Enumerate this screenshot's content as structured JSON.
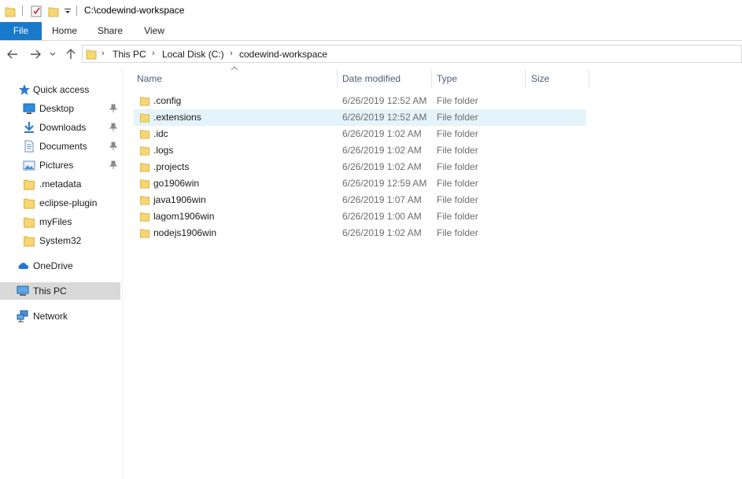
{
  "window": {
    "title": "C:\\codewind-workspace"
  },
  "ribbon": {
    "tabs": [
      "File",
      "Home",
      "Share",
      "View"
    ]
  },
  "address": {
    "crumbs": [
      "This PC",
      "Local Disk (C:)",
      "codewind-workspace"
    ]
  },
  "nav": {
    "quick_access": "Quick access",
    "items": [
      {
        "label": "Desktop",
        "icon": "desktop-icon",
        "pinned": true
      },
      {
        "label": "Downloads",
        "icon": "downloads-icon",
        "pinned": true
      },
      {
        "label": "Documents",
        "icon": "documents-icon",
        "pinned": true
      },
      {
        "label": "Pictures",
        "icon": "pictures-icon",
        "pinned": true
      },
      {
        "label": ".metadata",
        "icon": "folder-icon",
        "pinned": false
      },
      {
        "label": "eclipse-plugin",
        "icon": "folder-icon",
        "pinned": false
      },
      {
        "label": "myFiles",
        "icon": "folder-icon",
        "pinned": false
      },
      {
        "label": "System32",
        "icon": "folder-icon",
        "pinned": false
      }
    ],
    "onedrive": "OneDrive",
    "thispc": "This PC",
    "network": "Network"
  },
  "columns": {
    "name": "Name",
    "date": "Date modified",
    "type": "Type",
    "size": "Size"
  },
  "files": [
    {
      "name": ".config",
      "date": "6/26/2019 12:52 AM",
      "type": "File folder"
    },
    {
      "name": ".extensions",
      "date": "6/26/2019 12:52 AM",
      "type": "File folder"
    },
    {
      "name": ".idc",
      "date": "6/26/2019 1:02 AM",
      "type": "File folder"
    },
    {
      "name": ".logs",
      "date": "6/26/2019 1:02 AM",
      "type": "File folder"
    },
    {
      "name": ".projects",
      "date": "6/26/2019 1:02 AM",
      "type": "File folder"
    },
    {
      "name": "go1906win",
      "date": "6/26/2019 12:59 AM",
      "type": "File folder"
    },
    {
      "name": "java1906win",
      "date": "6/26/2019 1:07 AM",
      "type": "File folder"
    },
    {
      "name": "lagom1906win",
      "date": "6/26/2019 1:00 AM",
      "type": "File folder"
    },
    {
      "name": "nodejs1906win",
      "date": "6/26/2019 1:02 AM",
      "type": "File folder"
    }
  ],
  "colors": {
    "file_tab": "#1979ca",
    "folder": "#f7d774",
    "hover_row": "#e5f3fb",
    "selected_nav": "#d9d9d9",
    "header_text": "#4c607a"
  }
}
